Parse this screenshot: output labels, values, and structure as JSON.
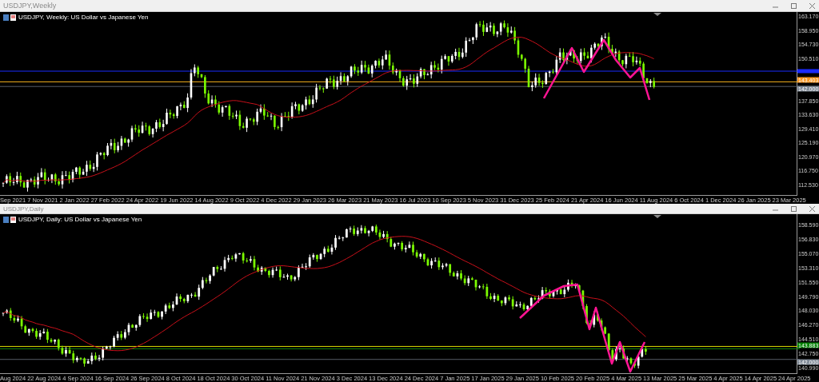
{
  "windows": [
    {
      "title": "USDJPY,Weekly",
      "legend": "USDJPY, Weekly:  US Dollar vs Japanese Yen",
      "kind": "weekly",
      "price_ticks": [
        "163.170",
        "158.950",
        "154.730",
        "150.510",
        "137.850",
        "133.630",
        "129.410",
        "125.190",
        "120.970",
        "116.750",
        "112.530"
      ],
      "price_tags": [
        {
          "text": "143.403",
          "color": "#f7941d"
        },
        {
          "text": "142.000",
          "color": "#7d8794"
        }
      ],
      "date_ticks": [
        "Sep 2021",
        "7 Nov 2021",
        "2 Jan 2022",
        "27 Feb 2022",
        "24 Apr 2022",
        "19 Jun 2022",
        "14 Aug 2022",
        "9 Oct 2022",
        "4 Dec 2022",
        "29 Jan 2023",
        "26 Mar 2023",
        "21 May 2023",
        "16 Jul 2023",
        "10 Sep 2023",
        "5 Nov 2023",
        "31 Dec 2023",
        "25 Feb 2024",
        "21 Apr 2024",
        "16 Jun 2024",
        "11 Aug 2024",
        "6 Oct 2024",
        "1 Dec 2024",
        "26 Jan 2025",
        "23 Mar 2025"
      ]
    },
    {
      "title": "USDJPY,Daily",
      "legend": "USDJPY, Daily:  US Dollar vs Japanese Yen",
      "kind": "daily",
      "price_ticks": [
        "158.590",
        "156.830",
        "155.070",
        "153.310",
        "151.550",
        "149.790",
        "148.030",
        "146.270",
        "144.510",
        "142.750",
        "140.990"
      ],
      "price_tags": [
        {
          "text": "143.883",
          "color": "#008000"
        },
        {
          "text": "142.000",
          "color": "#7d8794"
        }
      ],
      "date_ticks": [
        "Aug 2024",
        "22 Aug 2024",
        "4 Sep 2024",
        "16 Sep 2024",
        "26 Sep 2024",
        "8 Oct 2024",
        "18 Oct 2024",
        "30 Oct 2024",
        "11 Nov 2024",
        "21 Nov 2024",
        "3 Dec 2024",
        "13 Dec 2024",
        "24 Dec 2024",
        "7 Jan 2025",
        "17 Jan 2025",
        "29 Jan 2025",
        "10 Feb 2025",
        "20 Feb 2025",
        "4 Mar 2025",
        "13 Mar 2025",
        "25 Mar 2025",
        "4 Apr 2025",
        "14 Apr 2025",
        "24 Apr 2025"
      ]
    }
  ]
}
